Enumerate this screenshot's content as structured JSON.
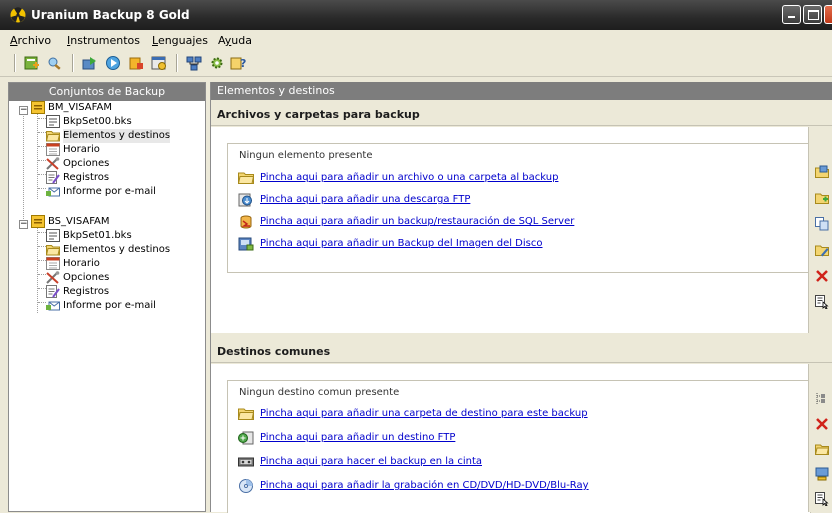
{
  "window": {
    "title": "Uranium Backup 8 Gold"
  },
  "menu": [
    {
      "label": "Archivo",
      "accel": "A"
    },
    {
      "label": "Instrumentos",
      "accel": "I"
    },
    {
      "label": "Lenguajes",
      "accel": "L"
    },
    {
      "label": "Ayuda",
      "accel": "y"
    }
  ],
  "toolbar": {
    "icons": [
      "new-backup-icon",
      "search-icon",
      "export-icon",
      "run-backup-icon",
      "restore-icon",
      "schedule-icon",
      "network-icon",
      "settings-icon",
      "help-icon"
    ]
  },
  "left_panel": {
    "header": "Conjuntos de Backup",
    "tree": [
      {
        "label": "BM_VISAFAM",
        "icon": "backup-set-icon",
        "level": 0,
        "expanded": true
      },
      {
        "label": "BkpSet00.bks",
        "icon": "file-icon",
        "level": 1
      },
      {
        "label": "Elementos y destinos",
        "icon": "folder-icon",
        "level": 1,
        "selected": true
      },
      {
        "label": "Horario",
        "icon": "calendar-icon",
        "level": 1
      },
      {
        "label": "Opciones",
        "icon": "tools-icon",
        "level": 1
      },
      {
        "label": "Registros",
        "icon": "log-icon",
        "level": 1
      },
      {
        "label": "Informe por e-mail",
        "icon": "email-icon",
        "level": 1
      },
      {
        "label": "BS_VISAFAM",
        "icon": "backup-set-icon",
        "level": 0,
        "expanded": true
      },
      {
        "label": "BkpSet01.bks",
        "icon": "file-icon",
        "level": 1
      },
      {
        "label": "Elementos y destinos",
        "icon": "folder-icon",
        "level": 1
      },
      {
        "label": "Horario",
        "icon": "calendar-icon",
        "level": 1
      },
      {
        "label": "Opciones",
        "icon": "tools-icon",
        "level": 1
      },
      {
        "label": "Registros",
        "icon": "log-icon",
        "level": 1
      },
      {
        "label": "Informe por e-mail",
        "icon": "email-icon",
        "level": 1
      }
    ]
  },
  "right_panel": {
    "header": "Elementos y destinos",
    "items_section": {
      "title": "Archivos y carpetas para backup",
      "empty_message": "Ningun elemento presente",
      "links": [
        {
          "label": "Pincha aqui para añadir un archivo o una carpeta al backup",
          "icon": "folder-icon"
        },
        {
          "label": "Pincha aqui para añadir una descarga FTP",
          "icon": "ftp-download-icon"
        },
        {
          "label": "Pincha aqui para añadir un backup/restauración de SQL Server",
          "icon": "sql-server-icon"
        },
        {
          "label": "Pincha aqui para añadir un Backup del Imagen del Disco",
          "icon": "disk-image-icon"
        }
      ],
      "side_tools": [
        "add-item-icon",
        "add-folder-icon",
        "copy-icon",
        "edit-icon",
        "delete-icon",
        "properties-icon"
      ]
    },
    "destinations_section": {
      "title": "Destinos comunes",
      "empty_message": "Ningun destino comun presente",
      "links": [
        {
          "label": "Pincha aqui para añadir una carpeta de destino para este backup",
          "icon": "folder-icon"
        },
        {
          "label": "Pincha aqui para añadir un destino FTP",
          "icon": "ftp-destination-icon"
        },
        {
          "label": "Pincha aqui para hacer el backup en la cinta",
          "icon": "tape-icon"
        },
        {
          "label": "Pincha aqui para añadir la grabación en CD/DVD/HD-DVD/Blu-Ray",
          "icon": "disc-icon"
        }
      ],
      "side_tools": [
        "tree-icon",
        "delete-icon",
        "folder-icon",
        "computer-icon",
        "properties-icon"
      ]
    }
  }
}
